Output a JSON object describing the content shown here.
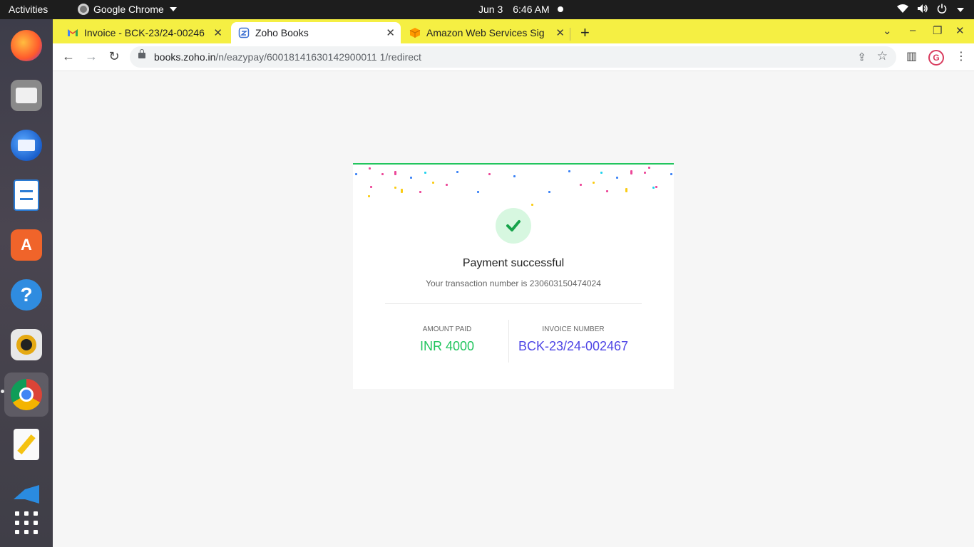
{
  "topbar": {
    "activities": "Activities",
    "app_name": "Google Chrome",
    "date": "Jun 3",
    "time": "6:46 AM"
  },
  "dock": {
    "items": [
      "firefox-icon",
      "files-icon",
      "thunderbird-icon",
      "writer-icon",
      "app-store-icon",
      "help-icon",
      "rhythmbox-icon",
      "chrome-icon",
      "text-editor-icon",
      "vscode-icon",
      "app-grid-icon"
    ]
  },
  "tabs": [
    {
      "title": "Invoice - BCK-23/24-00246",
      "favicon": "gmail-icon"
    },
    {
      "title": "Zoho Books",
      "favicon": "zoho-books-icon",
      "active": true
    },
    {
      "title": "Amazon Web Services Sig",
      "favicon": "aws-icon"
    }
  ],
  "address_bar": {
    "host": "books.zoho.in",
    "path": "/n/eazypay/60018141630142900011 1/redirect"
  },
  "payment": {
    "title": "Payment successful",
    "transaction_text": "Your transaction number is 230603150474024",
    "amount_label": "AMOUNT PAID",
    "amount_value": "INR 4000",
    "invoice_label": "INVOICE NUMBER",
    "invoice_value": "BCK-23/24-002467"
  },
  "colors": {
    "tabstrip": "#f5ef43",
    "success": "#22c55e",
    "invoice": "#4f46e5"
  }
}
